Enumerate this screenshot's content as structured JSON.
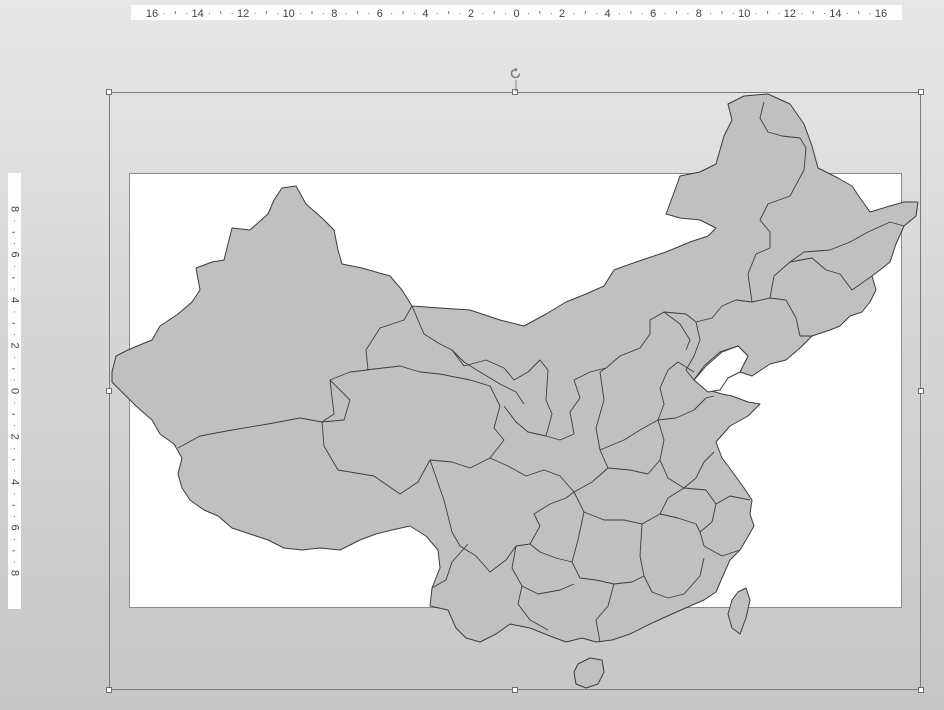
{
  "rulers": {
    "horizontal_ticks": [
      "16",
      "14",
      "12",
      "10",
      "8",
      "6",
      "4",
      "2",
      "0",
      "2",
      "4",
      "6",
      "8",
      "10",
      "12",
      "14",
      "16"
    ],
    "vertical_ticks": [
      "8",
      "6",
      "4",
      "2",
      "0",
      "2",
      "4",
      "6",
      "8"
    ]
  },
  "map": {
    "fill_color": "#c0c0c0",
    "stroke_color": "#3c3c3c"
  },
  "selection": {
    "handle_color": "#ffffff",
    "border_color": "#7a7a7a"
  },
  "icons": {
    "rotate": "rotate-handle-icon"
  }
}
